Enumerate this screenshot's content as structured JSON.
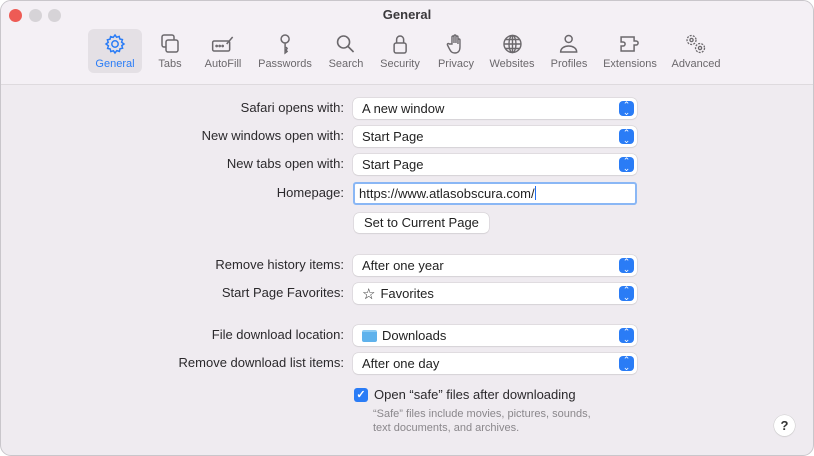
{
  "window": {
    "title": "General"
  },
  "toolbar": {
    "items": [
      {
        "label": "General",
        "icon": "gear-icon"
      },
      {
        "label": "Tabs",
        "icon": "tabs-icon"
      },
      {
        "label": "AutoFill",
        "icon": "autofill-icon"
      },
      {
        "label": "Passwords",
        "icon": "key-icon"
      },
      {
        "label": "Search",
        "icon": "search-icon"
      },
      {
        "label": "Security",
        "icon": "lock-icon"
      },
      {
        "label": "Privacy",
        "icon": "hand-icon"
      },
      {
        "label": "Websites",
        "icon": "globe-icon"
      },
      {
        "label": "Profiles",
        "icon": "person-icon"
      },
      {
        "label": "Extensions",
        "icon": "puzzle-icon"
      },
      {
        "label": "Advanced",
        "icon": "gears-icon"
      }
    ]
  },
  "settings": {
    "safari_opens_label": "Safari opens with:",
    "safari_opens_value": "A new window",
    "new_windows_label": "New windows open with:",
    "new_windows_value": "Start Page",
    "new_tabs_label": "New tabs open with:",
    "new_tabs_value": "Start Page",
    "homepage_label": "Homepage:",
    "homepage_value": "https://www.atlasobscura.com/",
    "set_current_label": "Set to Current Page",
    "remove_history_label": "Remove history items:",
    "remove_history_value": "After one year",
    "favorites_label": "Start Page Favorites:",
    "favorites_value": "Favorites",
    "download_location_label": "File download location:",
    "download_location_value": "Downloads",
    "remove_downloads_label": "Remove download list items:",
    "remove_downloads_value": "After one day",
    "open_safe_label": "Open “safe” files after downloading",
    "open_safe_checked": true,
    "note_line1": "“Safe” files include movies, pictures, sounds,",
    "note_line2": "text documents, and archives."
  },
  "help": "?",
  "colors": {
    "accent": "#2a7cf6",
    "close": "#ee5b55"
  }
}
